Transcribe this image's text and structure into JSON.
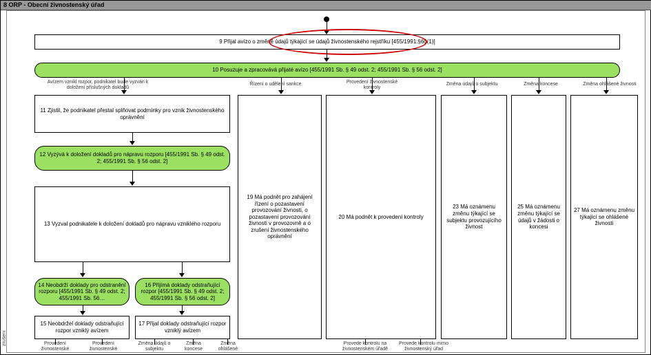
{
  "header": {
    "title": "8 ORP - Obecní živnostenský úřad"
  },
  "sidelabel": "Řízení o zrušení",
  "nodes": {
    "n9": "9 Přijal avízo o změně údajů týkající se údajů živnostenského rejstříku [455/1991:§60(1)]",
    "n10": "10 Posuzuje a zpracovává přijaté avízo [455/1991 Sb. § 49 odst. 2; 455/1991 Sb. § 56 odst. 2]",
    "n11": "11 Zjistil, že podnikatel přestal splňovat podmínky pro vznik živnostenského oprávnění",
    "n12": "12 Vyzývá k doložení dokladů pro nápravu rozporu [455/1991 Sb. § 49 odst. 2; 455/1991 Sb. § 56 odst. 2]",
    "n13": "13 Vyzval podnikatele k doložení dokladů pro nápravu vzniklého rozporu",
    "n14": "14 Neobdrží doklady pro odstranění rozporu [455/1991 Sb. § 49 odst. 2; 455/1991 Sb. 56…",
    "n15": "15 Neobdržel doklady odstraňující rozpor vzniklý avízem",
    "n16": "16 Přijímá doklady odstraňující rozpor [455/1991 Sb. § 49 odst. 2; 455/1991 Sb. § 56 odst. 2]",
    "n17": "17 Přijal doklady odstraňující rozpor vzniklý avízem",
    "n19": "19 Má podnět pro zahájení řízení o pozastavení provozování živnosti, o pozastavení provozování živnosti v provozovně a o zrušení živnostenského oprávnění",
    "n20": "20 Má podnět k provedení kontroly",
    "n23": "23 Má oznámenu změnu týkající se subjektu provozujícího živnost",
    "n25": "25 Má oznámenu změnu týkající se údajů v žádosti o koncesi",
    "n27": "27 Má oznámenu změnu týkající se ohlášené živnosti"
  },
  "edge_labels": {
    "l_a": "Avízem vznikl rozpor, podnikatel bude vyzván k doložení příslušných dokladů",
    "l_b": "Řízení o udělení sankce",
    "l_c": "Provedení živnostenské kontroly",
    "l_d": "Změna údajů o subjektu",
    "l_e": "Změna koncese",
    "l_f": "Změna ohlášené živnosti",
    "bot_1": "Provedení živnostenské",
    "bot_2": "Provedení živnostenské",
    "bot_3": "Změna údajů o subjektu",
    "bot_4": "Změna koncese",
    "bot_5": "Změna ohlášené",
    "bot_6": "Provede kontrolu na živnostenském úřadě",
    "bot_7": "Provede kontrolu mimo živnostenský úřad"
  }
}
